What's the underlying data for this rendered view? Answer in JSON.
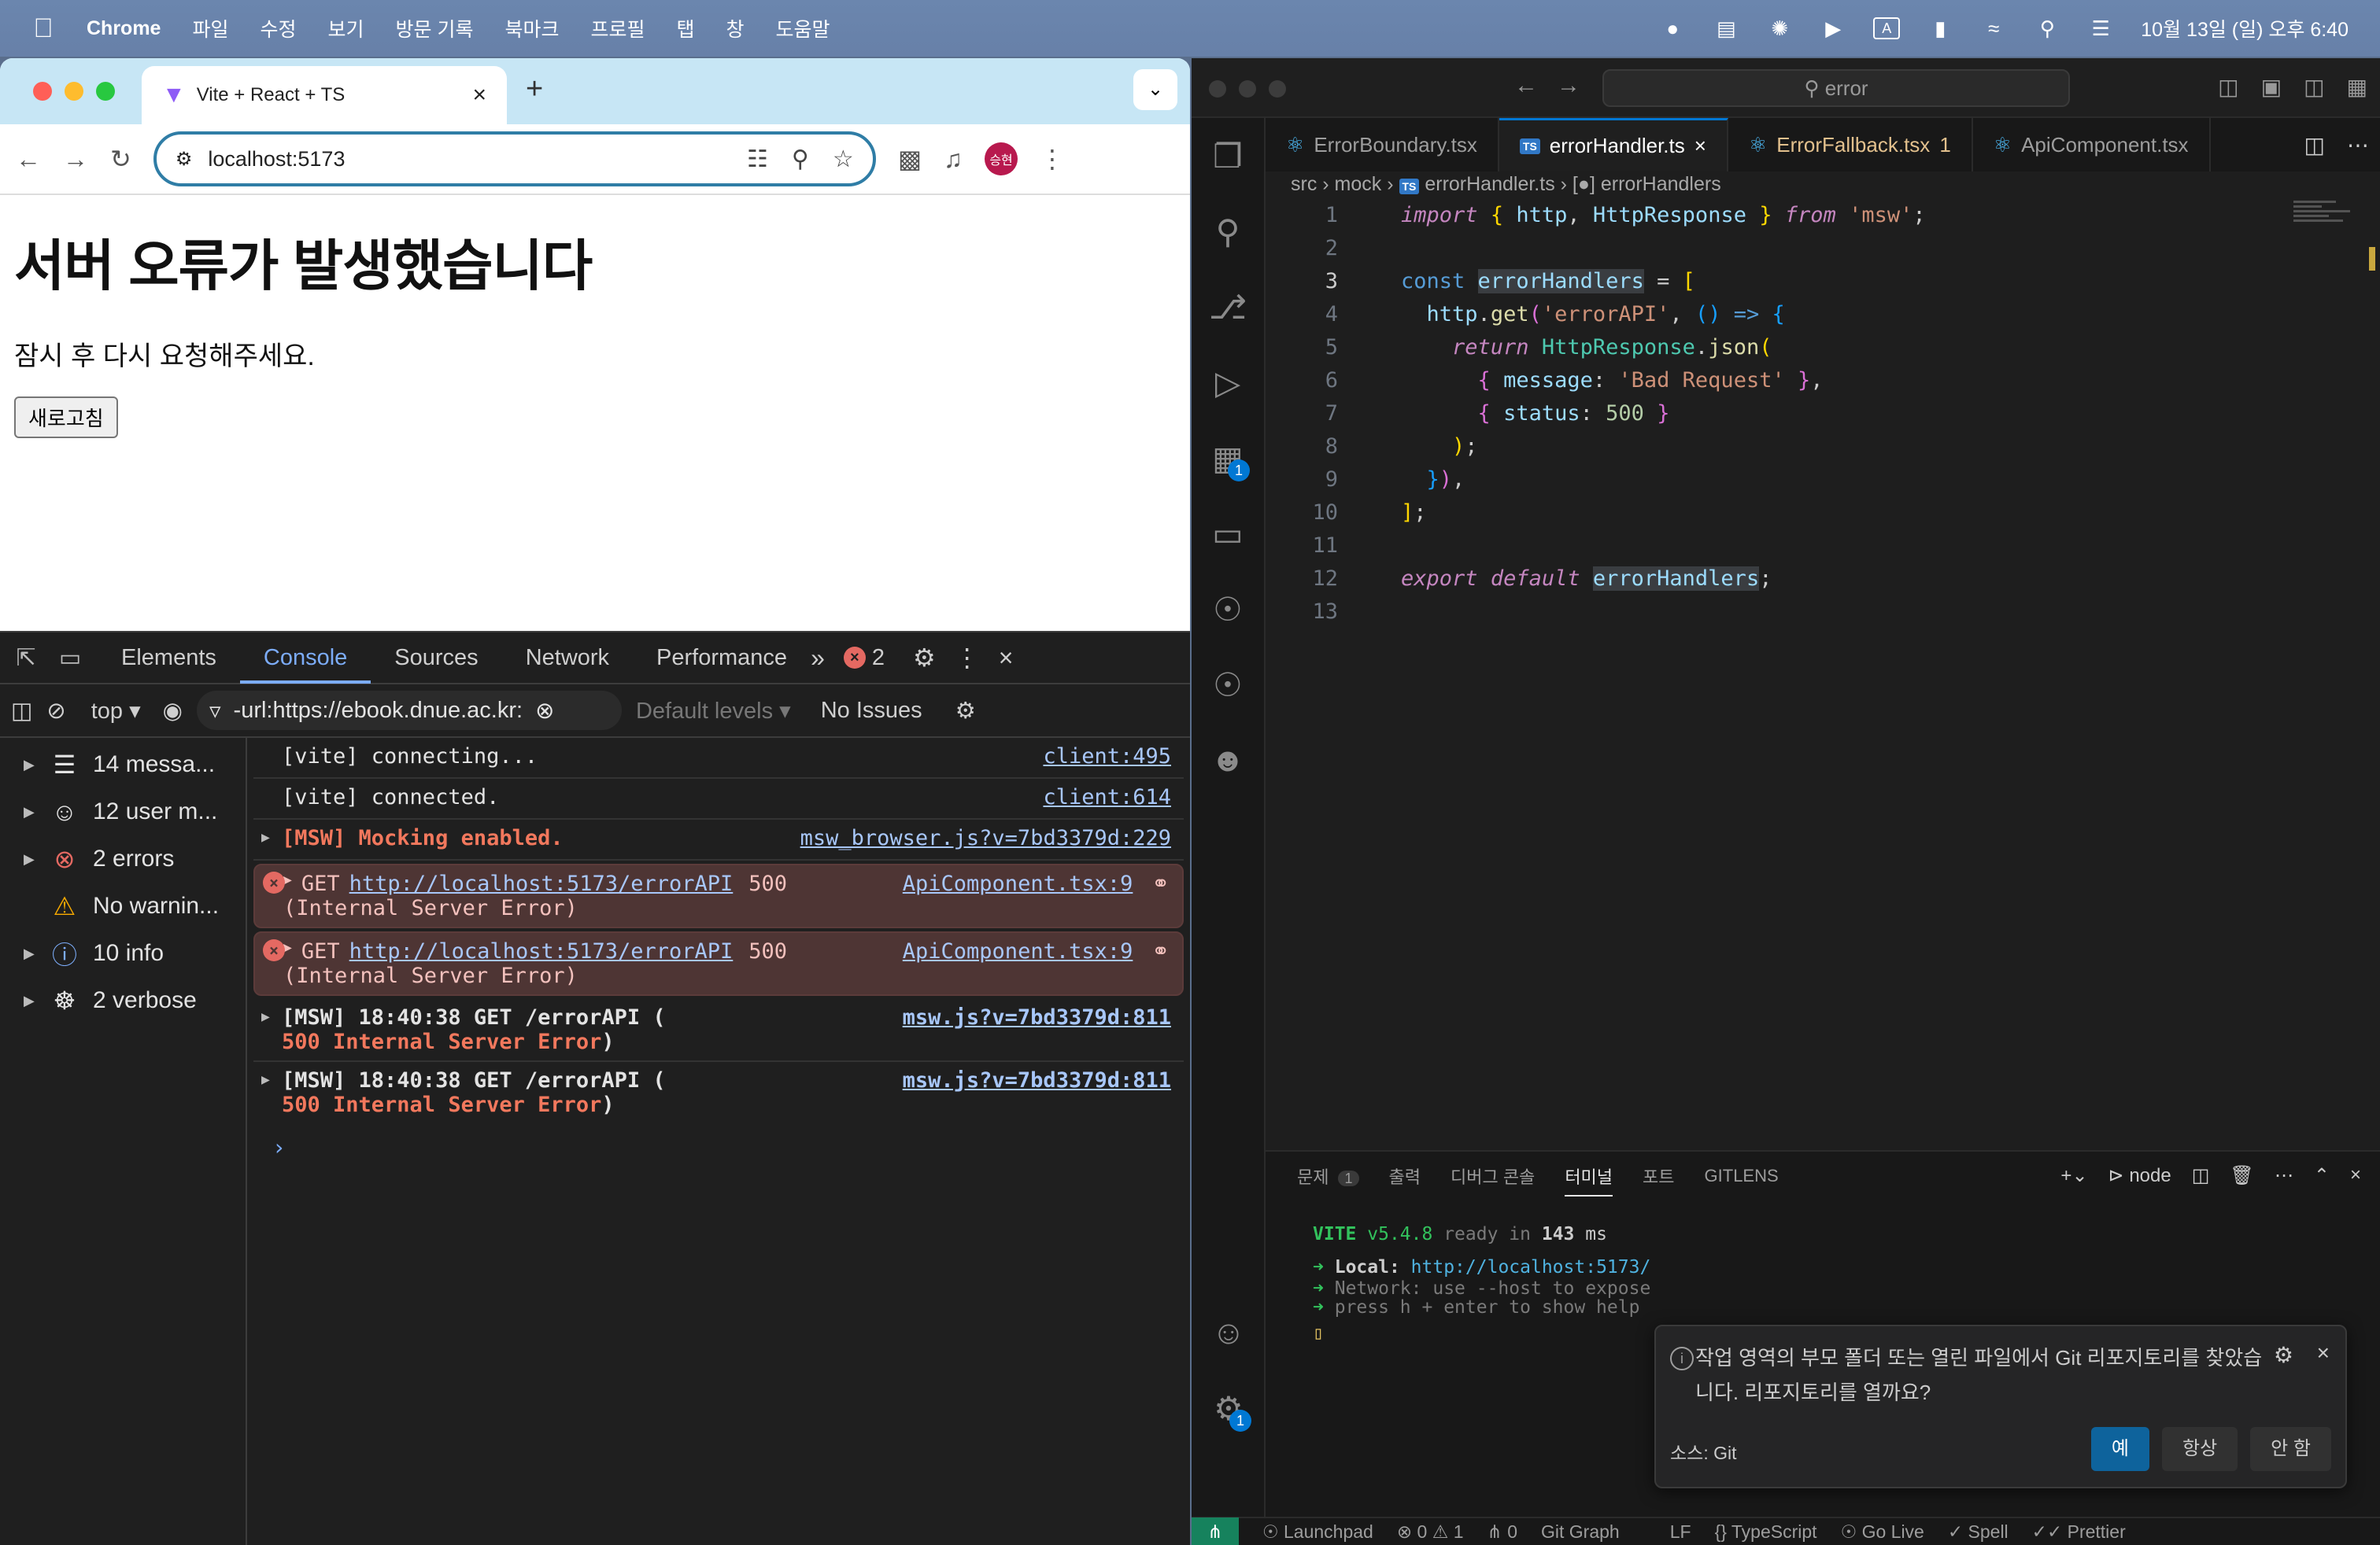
{
  "menubar": {
    "app": "Chrome",
    "items": [
      "파일",
      "수정",
      "보기",
      "방문 기록",
      "북마크",
      "프로필",
      "탭",
      "창",
      "도움말"
    ],
    "datetime": "10월 13일 (일) 오후 6:40",
    "status_icons": [
      "record-icon",
      "display-icon",
      "chatgpt-icon",
      "play-icon",
      "input-source-icon",
      "battery-icon",
      "wifi-icon",
      "search-icon",
      "control-center-icon"
    ]
  },
  "chrome": {
    "tab_title": "Vite + React + TS",
    "url": "localhost:5173",
    "avatar_initials": "승현",
    "page": {
      "heading": "서버 오류가 발생했습니다",
      "message": "잠시 후 다시 요청해주세요.",
      "button": "새로고침"
    }
  },
  "devtools": {
    "tabs": [
      "Elements",
      "Console",
      "Sources",
      "Network",
      "Performance"
    ],
    "active_tab": "Console",
    "error_count": "2",
    "context": "top",
    "filter_value": "-url:https://ebook.dnue.ac.kr:",
    "levels": "Default levels",
    "issues": "No Issues",
    "sidebar": [
      {
        "icon": "list-icon",
        "label": "14 messa..."
      },
      {
        "icon": "user-icon",
        "label": "12 user m..."
      },
      {
        "icon": "error-icon",
        "label": "2 errors"
      },
      {
        "icon": "warning-icon",
        "label": "No warnin..."
      },
      {
        "icon": "info-icon",
        "label": "10 info"
      },
      {
        "icon": "bug-icon",
        "label": "2 verbose"
      }
    ],
    "logs": [
      {
        "text": "[vite] connecting...",
        "source": "client:495"
      },
      {
        "text": "[vite] connected.",
        "source": "client:614"
      },
      {
        "text": "[MSW] Mocking enabled.",
        "source": "msw_browser.js?v=7bd3379d:229"
      },
      {
        "method": "GET",
        "url": "http://localhost:5173/errorAPI",
        "status": "500",
        "source": "ApiComponent.tsx:9",
        "detail": "(Internal Server Error)"
      },
      {
        "method": "GET",
        "url": "http://localhost:5173/errorAPI",
        "status": "500",
        "source": "ApiComponent.tsx:9",
        "detail": "(Internal Server Error)"
      },
      {
        "prefix": "[MSW] 18:40:38 GET /errorAPI (",
        "detail": "500 Internal Server Error",
        "suffix": ")",
        "source": "msw.js?v=7bd3379d:811"
      },
      {
        "prefix": "[MSW] 18:40:38 GET /errorAPI (",
        "detail": "500 Internal Server Error",
        "suffix": ")",
        "source": "msw.js?v=7bd3379d:811"
      }
    ]
  },
  "vscode": {
    "search": "error",
    "tabs": [
      {
        "label": "ErrorBoundary.tsx"
      },
      {
        "label": "errorHandler.ts"
      },
      {
        "label": "ErrorFallback.tsx",
        "badge": "1"
      },
      {
        "label": "ApiComponent.tsx"
      }
    ],
    "breadcrumb": [
      "src",
      "mock",
      "errorHandler.ts",
      "errorHandlers"
    ],
    "line_numbers": [
      "1",
      "2",
      "3",
      "4",
      "5",
      "6",
      "7",
      "8",
      "9",
      "10",
      "11",
      "12",
      "13"
    ],
    "panel": {
      "tabs": [
        "문제",
        "출력",
        "디버그 콘솔",
        "터미널",
        "포트",
        "GITLENS"
      ],
      "problems_count": "1",
      "active_tab": "터미널",
      "shell": "node",
      "terminal": {
        "vite": "VITE",
        "version": "v5.4.8",
        "ready": "ready in",
        "ms": "143",
        "ms_unit": "ms",
        "local_label": "Local:",
        "local_url": "http://localhost:5173/",
        "network_line": "Network: use --host to expose",
        "help_line": "press h + enter to show help"
      }
    },
    "notification": {
      "message": "작업 영역의 부모 폴더 또는 열린 파일에서 Git 리포지토리를 찾았습니다. 리포지토리를 열까요?",
      "source": "소스: Git",
      "buttons": [
        "예",
        "항상",
        "안 함"
      ]
    },
    "statusbar": [
      "Launchpad",
      "0",
      "1",
      "0",
      "Git Graph",
      "LF",
      "TypeScript",
      "Go Live",
      "Spell",
      "Prettier"
    ],
    "activity_badges": [
      "1",
      "1"
    ]
  }
}
